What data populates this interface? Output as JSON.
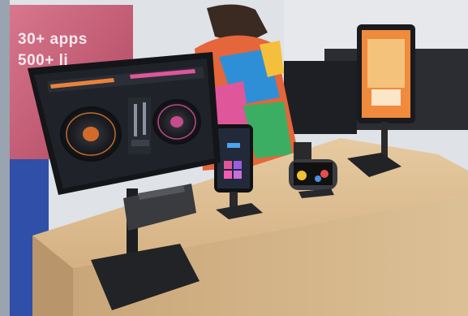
{
  "photo": {
    "description_tags": [
      "tablet",
      "smartphone",
      "game-controller-phone",
      "stand"
    ],
    "banner": {
      "line1": "30+ apps",
      "line2": "500+ li"
    },
    "colors": {
      "wall": "#d9dde3",
      "banner": "#c7566f",
      "table": "#d8b98a",
      "table_front": "#caa778",
      "stand": "#2a2a2c",
      "screen_dark": "#1c1f26",
      "accent_orange": "#e8833a",
      "accent_pink": "#e0569a"
    }
  }
}
